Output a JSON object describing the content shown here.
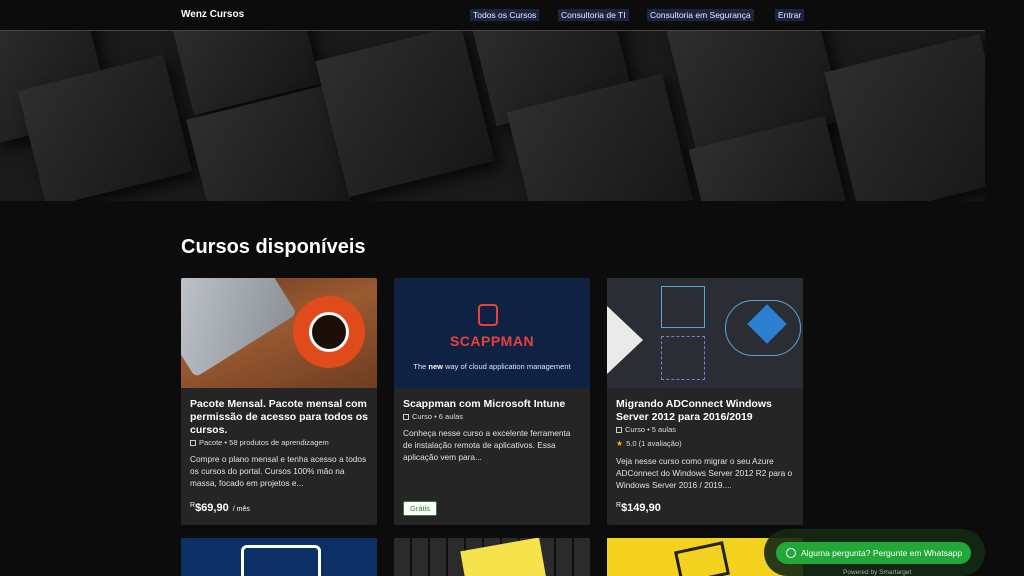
{
  "header": {
    "brand": "Wenz Cursos",
    "nav": [
      "Todos os Cursos",
      "Consultoria de TI",
      "Consultoria em Segurança",
      "Entrar"
    ]
  },
  "main": {
    "title": "Cursos disponíveis",
    "cards": [
      {
        "title": "Pacote Mensal. Pacote mensal com permissão de acesso para todos os cursos.",
        "meta": "Pacote • 58 produtos de aprendizagem",
        "description": "Compre o plano mensal e tenha acesso a todos os cursos do portal. Cursos 100% mão na massa, focado em projetos e...",
        "price_currency": "R",
        "price_value": "$69,90",
        "price_period": "/ mês"
      },
      {
        "title": "Scappman com Microsoft Intune",
        "meta": "Curso • 6 aulas",
        "description": "Conheça nesse curso a excelente ferramenta de instalação remota de aplicativos. Essa aplicação vem para...",
        "badge": "Grátis",
        "thumb_brand": "SCAPPMAN",
        "thumb_tagline_pre": "The ",
        "thumb_tagline_em": "new",
        "thumb_tagline_post": " way of cloud application management"
      },
      {
        "title": "Migrando ADConnect Windows Server 2012 para 2016/2019",
        "meta": "Curso • 5 aulas",
        "rating": "5.0 (1 avaliação)",
        "description": "Veja nesse curso como migrar o seu Azure ADConnect do Windows Server 2012 R2 para o Windows Server 2016 / 2019....",
        "price_currency": "R",
        "price_value": "$149,90"
      }
    ]
  },
  "whatsapp": {
    "label": "Alguma pergunta? Pergunte em Whatsapp",
    "powered": "Powered by Smartarget"
  },
  "colors": {
    "nav_bg": "#1b2541",
    "card_bg": "#252525",
    "whatsapp_green": "#22a838",
    "scappman_red": "#e8413b"
  }
}
